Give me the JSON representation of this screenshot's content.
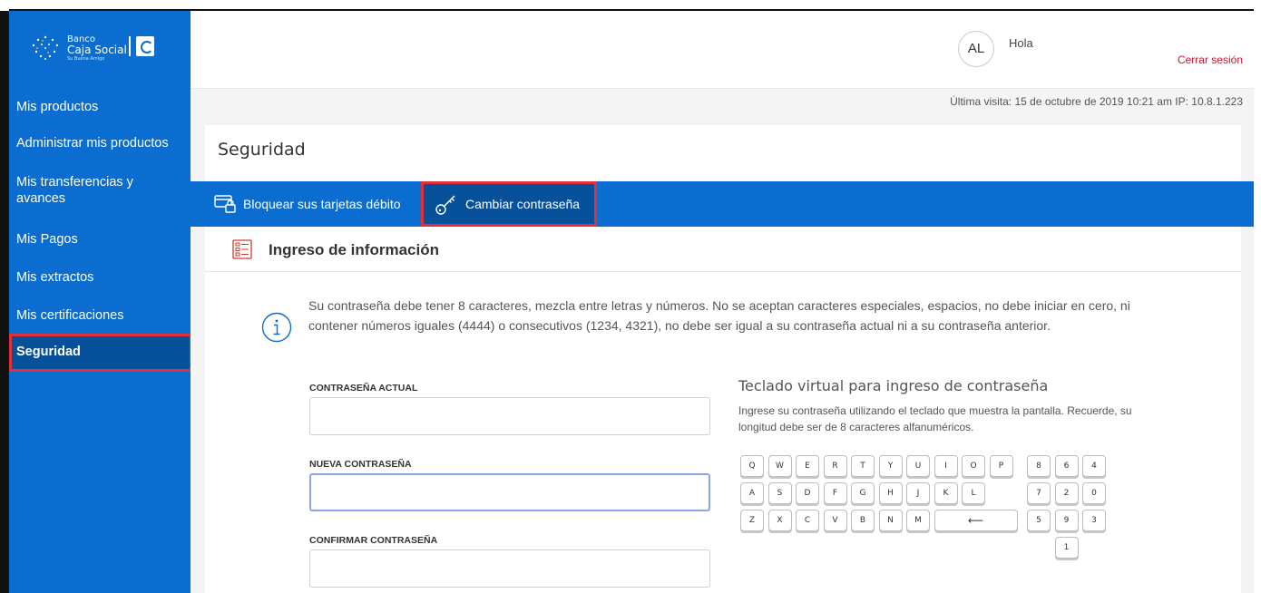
{
  "brand": {
    "line1": "Banco",
    "line2": "Caja Social",
    "tagline": "Su Buena Amigo"
  },
  "sidebar": {
    "items": [
      {
        "label": "Mis productos"
      },
      {
        "label": "Administrar mis productos"
      },
      {
        "label": "Mis transferencias y avances"
      },
      {
        "label": "Mis Pagos"
      },
      {
        "label": "Mis extractos"
      },
      {
        "label": "Mis certificaciones"
      },
      {
        "label": "Seguridad",
        "active": true
      }
    ]
  },
  "header": {
    "avatar_initials": "AL",
    "greeting": "Hola",
    "logout_label": "Cerrar sesión"
  },
  "last_visit": "Última visita: 15 de octubre de 2019 10:21 am  IP: 10.8.1.223",
  "page": {
    "title": "Seguridad",
    "tabs": [
      {
        "label": "Bloquear sus tarjetas débito"
      },
      {
        "label": "Cambiar contraseña",
        "active": true
      }
    ],
    "section_title": "Ingreso de información",
    "info_text": "Su contraseña debe tener 8 caracteres, mezcla entre letras y números. No se aceptan caracteres especiales, espacios, no debe iniciar en cero, ni contener números iguales (4444) o consecutivos (1234, 4321), no debe ser igual a su contraseña actual ni a su contraseña anterior."
  },
  "form": {
    "current_label": "CONTRASEÑA ACTUAL",
    "new_label": "NUEVA CONTRASEÑA",
    "confirm_label": "CONFIRMAR CONTRASEÑA"
  },
  "keyboard": {
    "title": "Teclado virtual para ingreso de contraseña",
    "description": "Ingrese su contraseña utilizando el teclado que muestra la pantalla. Recuerde, su longitud debe ser de 8 caracteres alfanuméricos.",
    "row1": [
      "Q",
      "W",
      "E",
      "R",
      "T",
      "Y",
      "U",
      "I",
      "O",
      "P"
    ],
    "row2": [
      "A",
      "S",
      "D",
      "F",
      "G",
      "H",
      "J",
      "K",
      "L"
    ],
    "row3": [
      "Z",
      "X",
      "C",
      "V",
      "B",
      "N",
      "M"
    ],
    "backspace": "⟵",
    "numpad": [
      "8",
      "6",
      "4",
      "7",
      "2",
      "0",
      "5",
      "9",
      "3",
      "1"
    ],
    "colors": {
      "brand_blue": "#0a6dcf",
      "highlight_red": "#e0303a"
    }
  }
}
